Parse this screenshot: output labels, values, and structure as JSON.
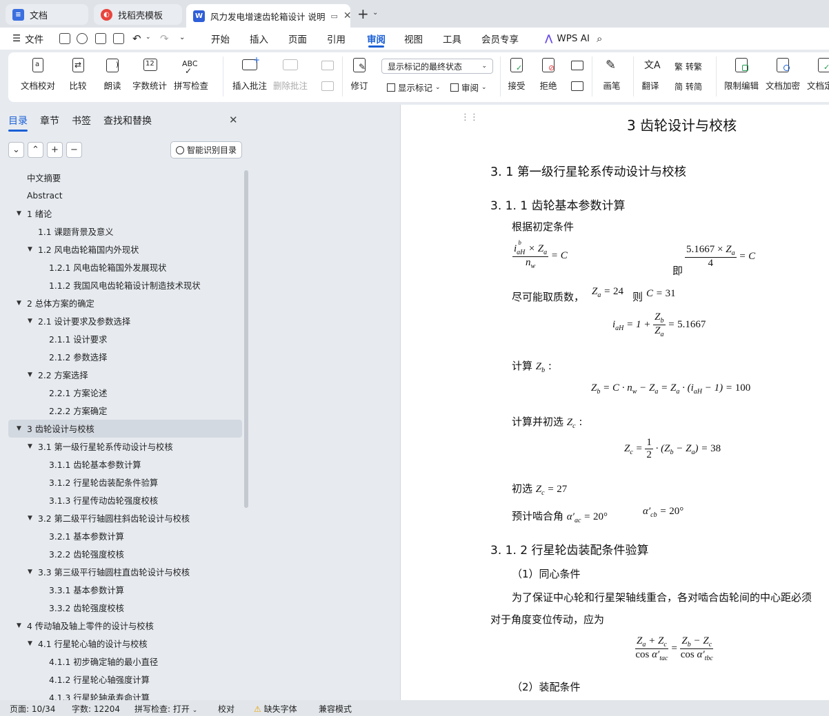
{
  "tabs": [
    {
      "label": "文档",
      "icon": "docs-icon",
      "color": "#3b6fe0"
    },
    {
      "label": "找稻壳模板",
      "icon": "docer-icon",
      "color": "#e8453c"
    },
    {
      "label": "风力发电增速齿轮箱设计 说明",
      "icon": "wps-writer-icon",
      "color": "#2f5fd8"
    }
  ],
  "menubar": {
    "file": "文件",
    "items": [
      "开始",
      "插入",
      "页面",
      "引用",
      "审阅",
      "视图",
      "工具",
      "会员专享"
    ],
    "selected": "审阅",
    "ai": "WPS AI"
  },
  "ribbon": {
    "buttons": [
      "文档校对",
      "比较",
      "朗读",
      "字数统计",
      "拼写检查",
      "插入批注",
      "删除批注",
      "修订",
      "显示标记",
      "审阅",
      "接受",
      "拒绝",
      "画笔",
      "翻译",
      "转繁",
      "转简",
      "限制编辑",
      "文档加密",
      "文档定稿"
    ],
    "display_select": "显示标记的最终状态"
  },
  "sidebar": {
    "tabs": [
      "目录",
      "章节",
      "书签",
      "查找和替换"
    ],
    "smart_button": "智能识别目录",
    "toc": [
      {
        "label": "中文摘要",
        "level": 0
      },
      {
        "label": "Abstract",
        "level": 0
      },
      {
        "label": "1  绪论",
        "level": 0,
        "expand": true
      },
      {
        "label": "1.1 课题背景及意义",
        "level": 1
      },
      {
        "label": "1.2 风电齿轮箱国内外现状",
        "level": 1,
        "expand": true
      },
      {
        "label": "1.2.1 风电齿轮箱国外发展现状",
        "level": 2
      },
      {
        "label": "1.1.2 我国风电齿轮箱设计制造技术现状",
        "level": 2
      },
      {
        "label": "2  总体方案的确定",
        "level": 0,
        "expand": true
      },
      {
        "label": "2.1 设计要求及参数选择",
        "level": 1,
        "expand": true
      },
      {
        "label": "2.1.1 设计要求",
        "level": 2
      },
      {
        "label": "2.1.2 参数选择",
        "level": 2
      },
      {
        "label": "2.2 方案选择",
        "level": 1,
        "expand": true
      },
      {
        "label": "2.2.1 方案论述",
        "level": 2
      },
      {
        "label": "2.2.2 方案确定",
        "level": 2
      },
      {
        "label": "3  齿轮设计与校核",
        "level": 0,
        "expand": true,
        "selected": true
      },
      {
        "label": "3.1 第一级行星轮系传动设计与校核",
        "level": 1,
        "expand": true
      },
      {
        "label": "3.1.1 齿轮基本参数计算",
        "level": 2
      },
      {
        "label": "3.1.2 行星轮齿装配条件验算",
        "level": 2
      },
      {
        "label": "3.1.3 行星传动齿轮强度校核",
        "level": 2
      },
      {
        "label": "3.2 第二级平行轴圆柱斜齿轮设计与校核",
        "level": 1,
        "expand": true
      },
      {
        "label": "3.2.1 基本参数计算",
        "level": 2
      },
      {
        "label": "3.2.2 齿轮强度校核",
        "level": 2
      },
      {
        "label": "3.3 第三级平行轴圆柱直齿轮设计与校核",
        "level": 1,
        "expand": true
      },
      {
        "label": "3.3.1 基本参数计算",
        "level": 2
      },
      {
        "label": "3.3.2 齿轮强度校核",
        "level": 2
      },
      {
        "label": "4 传动轴及轴上零件的设计与校核",
        "level": 0,
        "expand": true
      },
      {
        "label": "4.1 行星轮心轴的设计与校核",
        "level": 1,
        "expand": true
      },
      {
        "label": "4.1.1 初步确定轴的最小直径",
        "level": 2
      },
      {
        "label": "4.1.2 行星轮心轴强度计算",
        "level": 2
      },
      {
        "label": "4.1.3 行星轮轴承寿命计算",
        "level": 2
      }
    ]
  },
  "doc": {
    "chapter": "3  齿轮设计与校核",
    "h2": "3. 1 第一级行星轮系传动设计与校核",
    "h3a": "3. 1. 1 齿轮基本参数计算",
    "p1": "根据初定条件",
    "ji": "即",
    "p2": "尽可能取质数，",
    "ze": "则",
    "calc_zb": "计算",
    "calc_zc": "计算并初选",
    "chuxuan": "初选",
    "yuji": "预计啮合角",
    "h3b": "3. 1. 2 行星轮齿装配条件验算",
    "cond1": "（1）同心条件",
    "para1": "为了保证中心轮和行星架轴线重合，各对啮合齿轮间的中心距必须",
    "para2": "对于角度变位传动，应为",
    "cond2": "（2）装配条件",
    "eq_c": "5.1667",
    "eq_za": "24",
    "eq_C": "31",
    "eq_zb": "100",
    "eq_zc": "38",
    "eq_zc2": "27",
    "eq_angle": "20°"
  },
  "status": {
    "page": "页面: 10/34",
    "words": "字数: 12204",
    "spell": "拼写检查: 打开",
    "proof": "校对",
    "font": "缺失字体",
    "compat": "兼容模式"
  }
}
